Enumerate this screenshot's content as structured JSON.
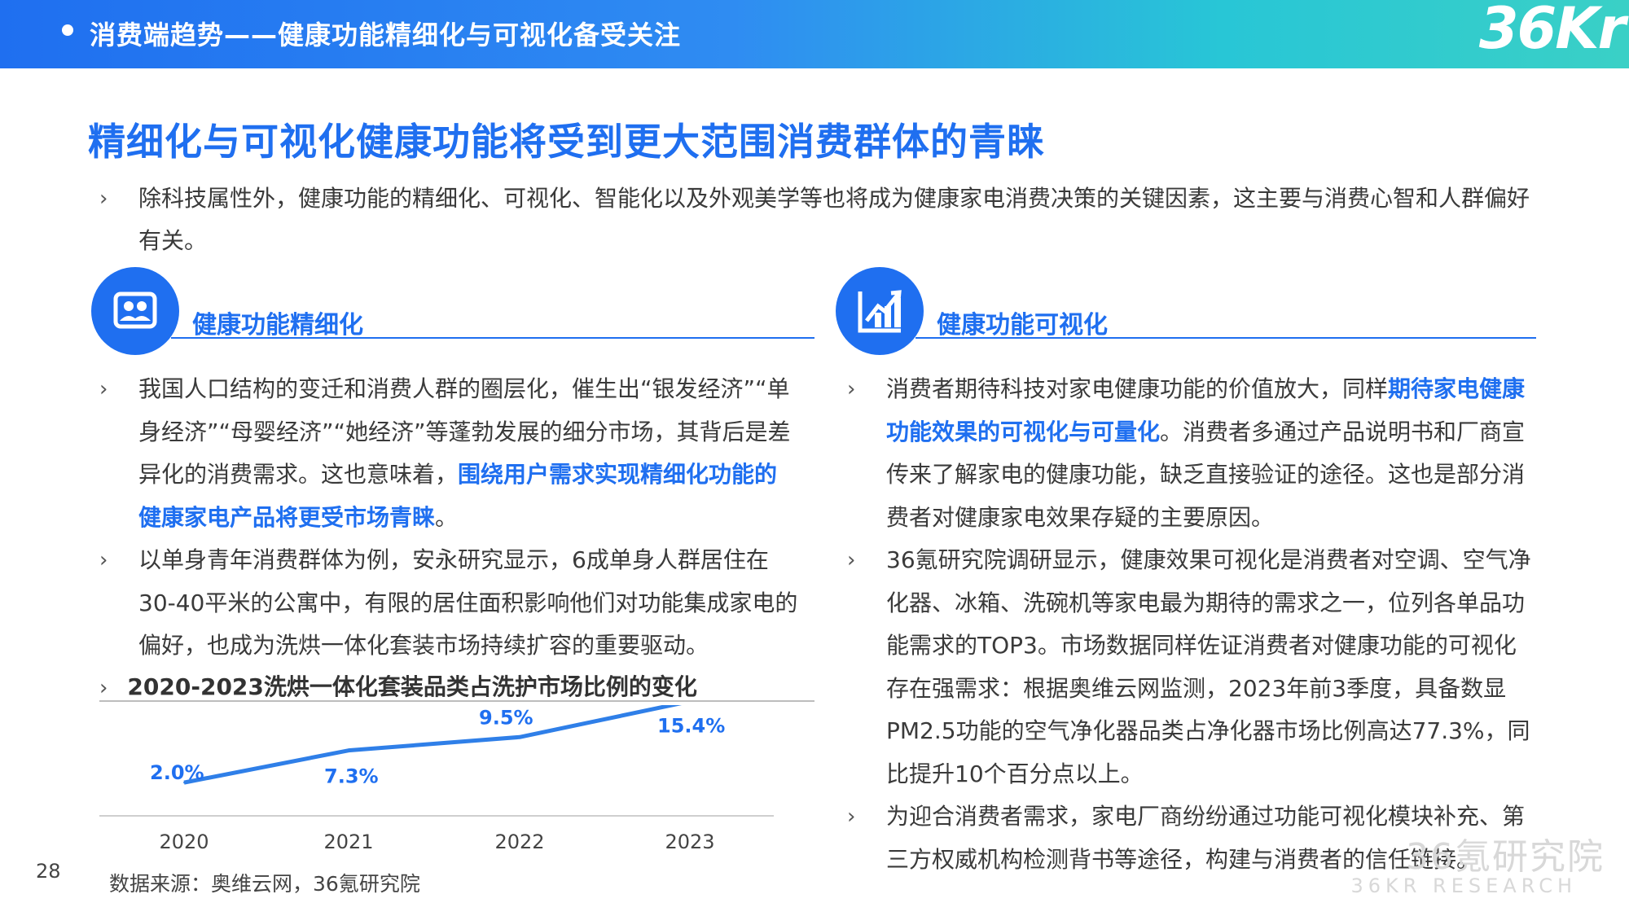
{
  "header": {
    "title": "消费端趋势——健康功能精细化与可视化备受关注",
    "brand": "36Kr"
  },
  "headline": "精细化与可视化健康功能将受到更大范围消费群体的青睐",
  "intro": "除科技属性外，健康功能的精细化、可视化、智能化以及外观美学等也将成为健康家电消费决策的关键因素，这主要与消费心智和人群偏好有关。",
  "left": {
    "title": "健康功能精细化",
    "p1_a": "我国人口结构的变迁和消费人群的圈层化，催生出“银发经济”“单身经济”“母婴经济”“她经济”等蓬勃发展的细分市场，其背后是差异化的消费需求。这也意味着，",
    "p1_hl": "围绕用户需求实现精细化功能的健康家电产品将更受市场青睐",
    "p1_end": "。",
    "p2": "以单身青年消费群体为例，安永研究显示，6成单身人群居住在30-40平米的公寓中，有限的居住面积影响他们对功能集成家电的偏好，也成为洗烘一体化套装市场持续扩容的重要驱动。"
  },
  "right": {
    "title": "健康功能可视化",
    "p1_a": "消费者期待科技对家电健康功能的价值放大，同样",
    "p1_hl": "期待家电健康功能效果的可视化与可量化",
    "p1_b": "。消费者多通过产品说明书和厂商宣传来了解家电的健康功能，缺乏直接验证的途径。这也是部分消费者对健康家电效果存疑的主要原因。",
    "p2": "36氪研究院调研显示，健康效果可视化是消费者对空调、空气净化器、冰箱、洗碗机等家电最为期待的需求之一，位列各单品功能需求的TOP3。市场数据同样佐证消费者对健康功能的可视化存在强需求：根据奥维云网监测，2023年前3季度，具备数显PM2.5功能的空气净化器品类占净化器市场比例高达77.3%，同比提升10个百分点以上。",
    "p3": "为迎合消费者需求，家电厂商纷纷通过功能可视化模块补充、第三方权威机构检测背书等途径，构建与消费者的信任链接。"
  },
  "chart_data": {
    "type": "line",
    "title": "2020-2023洗烘一体化套装品类占洗护市场比例的变化",
    "categories": [
      "2020",
      "2021",
      "2022",
      "2023"
    ],
    "values": [
      2.0,
      7.3,
      9.5,
      15.4
    ],
    "labels": [
      "2.0%",
      "7.3%",
      "9.5%",
      "15.4%"
    ],
    "line_color": "#2f7fe8",
    "ylim": [
      0,
      18
    ]
  },
  "source": "数据来源：奥维云网，36氪研究院",
  "page_number": "28",
  "watermark": {
    "cn": "36氪研究院",
    "en": "36KR  RESEARCH"
  },
  "colors": {
    "accent": "#1f6ff0"
  },
  "icons": {
    "left": "people-card-icon",
    "right": "growth-chart-icon",
    "bullet": "chevron-right-icon"
  }
}
